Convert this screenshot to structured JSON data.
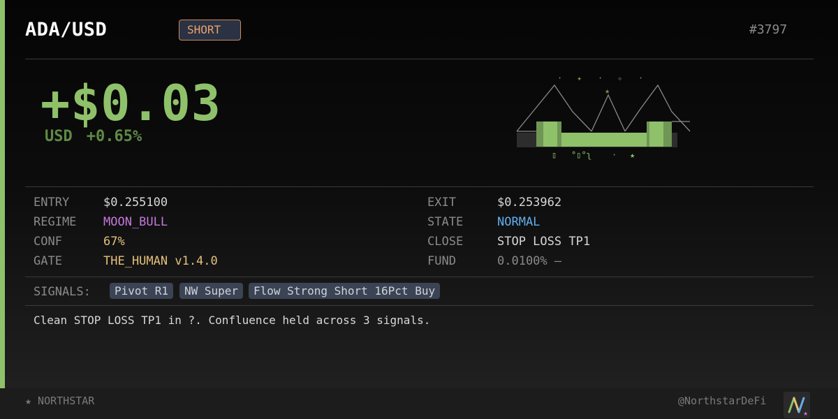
{
  "header": {
    "pair": "ADA/USD",
    "direction": "SHORT",
    "trade_id": "#3797"
  },
  "pnl": {
    "amount": "+$0.03",
    "currency": "USD",
    "percent": "+0.65%"
  },
  "fields": {
    "entry_label": "ENTRY",
    "entry_value": "$0.255100",
    "exit_label": "EXIT",
    "exit_value": "$0.253962",
    "regime_label": "REGIME",
    "regime_value": "MOON_BULL",
    "state_label": "STATE",
    "state_value": "NORMAL",
    "conf_label": "CONF",
    "conf_value": "67%",
    "close_label": "CLOSE",
    "close_value": "STOP LOSS TP1",
    "gate_label": "GATE",
    "gate_value": "THE_HUMAN v1.4.0",
    "fund_label": "FUND",
    "fund_value": "0.0100% —"
  },
  "signals": {
    "label": "SIGNALS:",
    "items": [
      "Pivot R1",
      "NW Super",
      "Flow Strong Short 16Pct Buy"
    ]
  },
  "summary": "Clean STOP LOSS TP1 in ?. Confluence held across 3 signals.",
  "footer": {
    "brand": "★ NORTHSTAR",
    "handle": "@NorthstarDeFi"
  },
  "colors": {
    "accent": "#8fc16a",
    "short": "#e8a16f",
    "regime": "#c678dd",
    "state": "#61afef",
    "conf": "#e5c07b",
    "gate": "#e5c07b"
  },
  "icons": {
    "art": "ascii-mountain-art",
    "logo": "northstar-logo-icon"
  }
}
